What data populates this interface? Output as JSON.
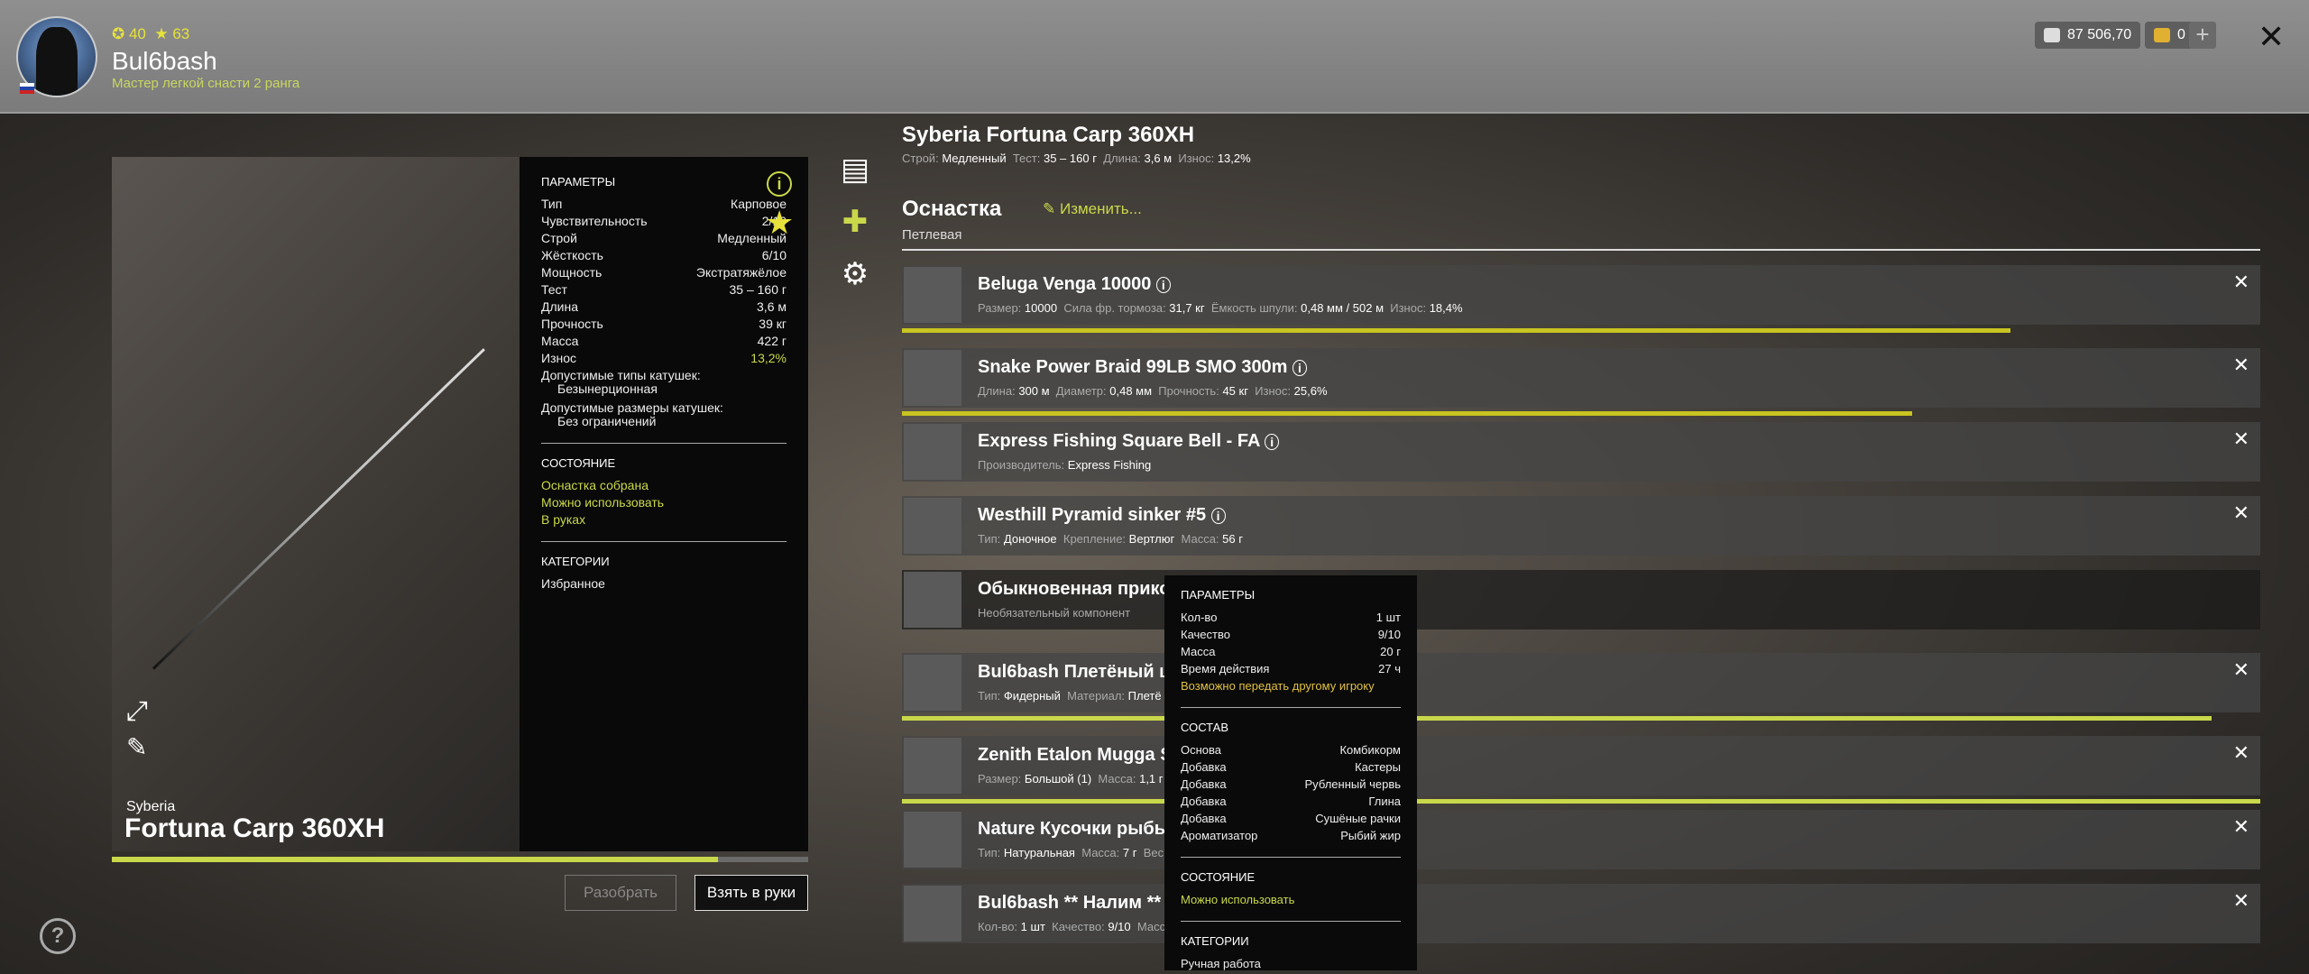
{
  "player": {
    "level": "40",
    "stars": "63",
    "name": "Bul6bash",
    "rank": "Мастер легкой снасти 2 ранга"
  },
  "currency": {
    "silver": "87 506,70",
    "gold": "0"
  },
  "rod": {
    "brand": "Syberia",
    "name": "Fortuna Carp 360XH",
    "full_title": "Syberia Fortuna Carp 360XH",
    "wear_fraction": 0.87,
    "params_header": "ПАРАМЕТРЫ",
    "params": [
      {
        "k": "Тип",
        "v": "Карповое"
      },
      {
        "k": "Чувствительность",
        "v": "2/10"
      },
      {
        "k": "Строй",
        "v": "Медленный"
      },
      {
        "k": "Жёсткость",
        "v": "6/10"
      },
      {
        "k": "Мощность",
        "v": "Экстратяжёлое"
      },
      {
        "k": "Тест",
        "v": "35 – 160 г"
      },
      {
        "k": "Длина",
        "v": "3,6 м"
      },
      {
        "k": "Прочность",
        "v": "39 кг"
      },
      {
        "k": "Масса",
        "v": "422 г"
      },
      {
        "k": "Износ",
        "v": "13,2%"
      }
    ],
    "reel_types_label": "Допустимые типы катушек:",
    "reel_types_value": "Безынерционная",
    "reel_sizes_label": "Допустимые размеры катушек:",
    "reel_sizes_value": "Без ограничений",
    "state_header": "СОСТОЯНИЕ",
    "states": [
      "Оснастка собрана",
      "Можно использовать",
      "В руках"
    ],
    "cat_header": "КАТЕГОРИИ",
    "category": "Избранное",
    "sub": {
      "l1": "Строй:",
      "v1": "Медленный",
      "l2": "Тест:",
      "v2": "35 – 160 г",
      "l3": "Длина:",
      "v3": "3,6 м",
      "l4": "Износ:",
      "v4": "13,2%"
    }
  },
  "buttons": {
    "disassemble": "Разобрать",
    "take": "Взять в руки"
  },
  "rig": {
    "title": "Оснастка",
    "type": "Петлевая",
    "change": "Изменить..."
  },
  "slots": [
    {
      "name": "Beluga Venga 10000",
      "desc": [
        [
          "Размер:",
          "10000"
        ],
        [
          "Сила фр. тормоза:",
          "31,7 кг"
        ],
        [
          "Ёмкость шпули:",
          "0,48 мм / 502 м"
        ],
        [
          "Износ:",
          "18,4%"
        ]
      ],
      "wear": 0.816,
      "bar_color": "#c8c420"
    },
    {
      "name": "Snake Power Braid 99LB SMO 300m",
      "desc": [
        [
          "Длина:",
          "300 м"
        ],
        [
          "Диаметр:",
          "0,48 мм"
        ],
        [
          "Прочность:",
          "45 кг"
        ],
        [
          "Износ:",
          "25,6%"
        ]
      ],
      "wear": 0.744,
      "bar_color": "#c8c420"
    },
    {
      "name": "Express Fishing Square Bell - FA",
      "desc": [
        [
          "Производитель:",
          "Express Fishing"
        ]
      ]
    },
    {
      "name": "Westhill Pyramid sinker #5",
      "desc": [
        [
          "Тип:",
          "Доночное"
        ],
        [
          "Крепление:",
          "Вертлюг"
        ],
        [
          "Масса:",
          "56 г"
        ]
      ]
    },
    {
      "name": "Обыкновенная прикор",
      "desc": [
        [
          "Необязательный компонент",
          ""
        ]
      ],
      "empty": true
    },
    {
      "name": "Bul6bash Плетёный шн",
      "desc": [
        [
          "Тип:",
          "Фидерный"
        ],
        [
          "Материал:",
          "Плетё"
        ],
        [
          "Износ:",
          "3,6%"
        ]
      ],
      "wear": 0.964,
      "bar_color": "#c8d84a"
    },
    {
      "name": "Zenith Etalon Mugga S1",
      "desc": [
        [
          "Размер:",
          "Большой (1)"
        ],
        [
          "Масса:",
          "1,1 г"
        ]
      ],
      "wear": 1.0,
      "bar_color": "#c8d84a"
    },
    {
      "name": "Nature Кусочки рыбы",
      "desc": [
        [
          "Тип:",
          "Натуральная"
        ],
        [
          "Масса:",
          "7 г"
        ],
        [
          "Вес",
          ""
        ]
      ]
    },
    {
      "name": "Bul6bash ** Налим **",
      "desc": [
        [
          "Кол-во:",
          "1 шт"
        ],
        [
          "Качество:",
          "9/10"
        ],
        [
          "Масса",
          ""
        ]
      ]
    }
  ],
  "tooltip": {
    "params_header": "ПАРАМЕТРЫ",
    "params": [
      {
        "k": "Кол-во",
        "v": "1 шт"
      },
      {
        "k": "Качество",
        "v": "9/10"
      },
      {
        "k": "Масса",
        "v": "20 г"
      },
      {
        "k": "Время действия",
        "v": "27 ч"
      }
    ],
    "transfer": "Возможно передать другому игроку",
    "comp_header": "СОСТАВ",
    "composition": [
      {
        "k": "Основа",
        "v": "Комбикорм"
      },
      {
        "k": "Добавка",
        "v": "Кастеры"
      },
      {
        "k": "Добавка",
        "v": "Рубленный червь"
      },
      {
        "k": "Добавка",
        "v": "Глина"
      },
      {
        "k": "Добавка",
        "v": "Сушёные рачки"
      },
      {
        "k": "Ароматизатор",
        "v": "Рыбий жир"
      }
    ],
    "state_header": "СОСТОЯНИЕ",
    "state": "Можно использовать",
    "cat_header": "КАТЕГОРИИ",
    "category": "Ручная работа"
  },
  "icons": [
    "avatar",
    "gear-icon",
    "star-icon",
    "info-icon",
    "expand-icon",
    "pencil-icon",
    "notes-icon",
    "puzzle-icon",
    "close-icon",
    "plus-icon",
    "help-icon"
  ]
}
